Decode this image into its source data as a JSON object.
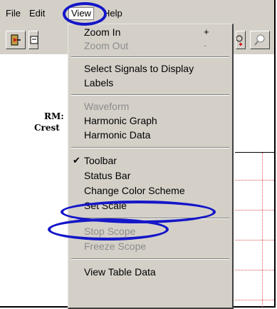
{
  "menubar": {
    "file": "File",
    "edit": "Edit",
    "view": "View",
    "help": "Help"
  },
  "toolbar": {
    "buttons": [
      "exit-icon",
      "print-icon",
      "zoom-in-icon",
      "zoom-out-icon"
    ]
  },
  "background": {
    "label_1": "RM:",
    "label_2": "Crest"
  },
  "view_menu": {
    "zoom_in": "Zoom In",
    "zoom_in_shortcut": "+",
    "zoom_out": "Zoom Out",
    "zoom_out_shortcut": "-",
    "select_signals": "Select Signals to Display",
    "labels": "Labels",
    "waveform": "Waveform",
    "harmonic_graph": "Harmonic Graph",
    "harmonic_data": "Harmonic Data",
    "toolbar": "Toolbar",
    "toolbar_check": "✔",
    "status_bar": "Status Bar",
    "change_color_scheme": "Change Color Scheme",
    "set_scale": "Set Scale",
    "stop_scope": "Stop Scope",
    "freeze_scope": "Freeze Scope",
    "view_table_data": "View Table Data"
  },
  "colors": {
    "annotation": "#1416c8",
    "menu_bg": "#d4d0c8",
    "disabled_text": "#8c8c8c",
    "grid_dots": "#e05050"
  }
}
